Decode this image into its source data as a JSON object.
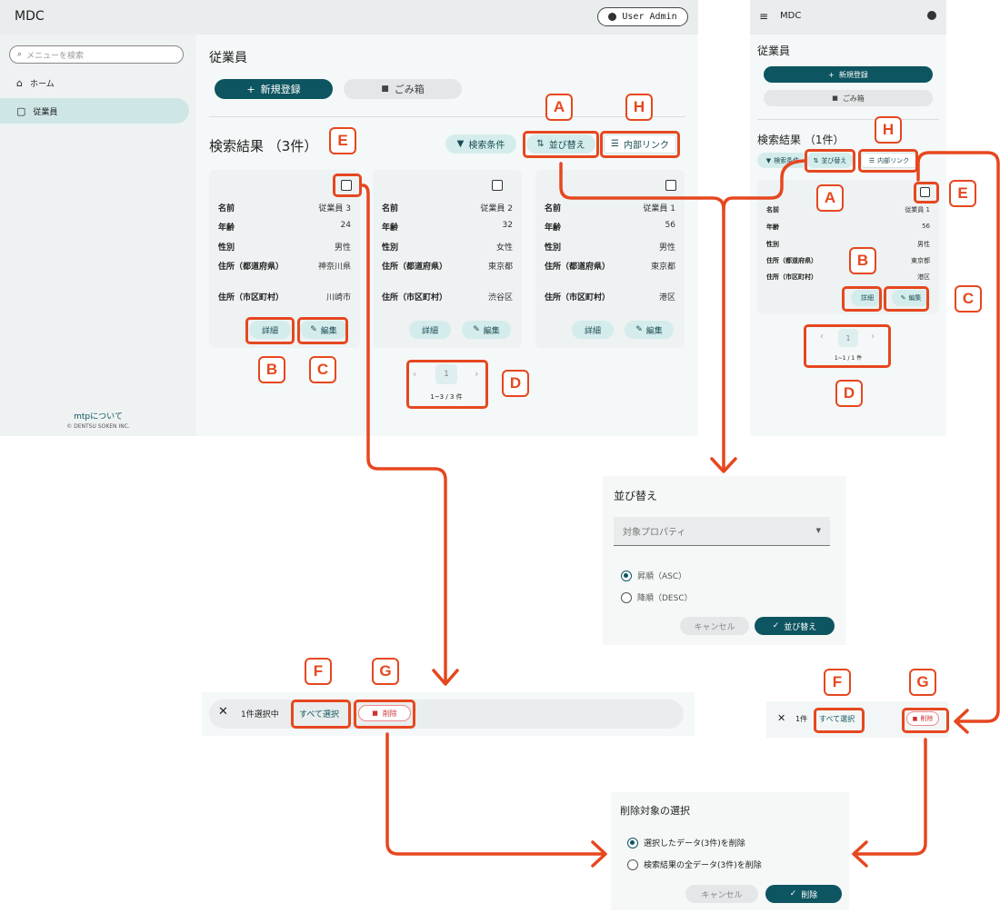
{
  "app": {
    "title": "MDC",
    "user": "User Admin"
  },
  "sidebar": {
    "search_placeholder": "メニューを検索",
    "items": [
      {
        "label": "ホーム"
      },
      {
        "label": "従業員"
      }
    ],
    "footer_link": "mtpについて",
    "footer_copy": "© DENTSU SOKEN INC."
  },
  "page": {
    "title": "従業員",
    "new_label": "新規登録",
    "trash_label": "ごみ箱",
    "results_title": "検索結果",
    "results_count": "（3件）",
    "filter_label": "検索条件",
    "sort_label": "並び替え",
    "link_label": "内部リンク"
  },
  "fields": [
    "名前",
    "年齢",
    "性別",
    "住所（都道府県）",
    "住所（市区町村）"
  ],
  "cards": [
    {
      "name": "従業員 3",
      "age": "24",
      "gender": "男性",
      "pref": "神奈川県",
      "city": "川崎市"
    },
    {
      "name": "従業員 2",
      "age": "32",
      "gender": "女性",
      "pref": "東京都",
      "city": "渋谷区"
    },
    {
      "name": "従業員 1",
      "age": "56",
      "gender": "男性",
      "pref": "東京都",
      "city": "港区"
    }
  ],
  "card_actions": {
    "detail": "詳細",
    "edit": "編集"
  },
  "pager": {
    "page": "1",
    "range": "1~3 / 3 件"
  },
  "mobile": {
    "title": "MDC",
    "page_title": "従業員",
    "new_label": "新規登録",
    "trash_label": "ごみ箱",
    "results_title": "検索結果",
    "results_count": "（1件）",
    "filter_label": "検索条件",
    "sort_label": "並び替え",
    "link_label": "内部リンク",
    "card": {
      "name": "従業員 1",
      "age": "56",
      "gender": "男性",
      "pref": "東京都",
      "city": "港区"
    },
    "fields": [
      "名前",
      "年齢",
      "性別",
      "住所（都道府県）",
      "住所（市区町村）"
    ],
    "pager": {
      "page": "1",
      "range": "1~1 / 1 件"
    },
    "select_count": "1件",
    "select_all": "すべて選択",
    "delete_label": "削除"
  },
  "sort_dialog": {
    "title": "並び替え",
    "select_placeholder": "対象プロパティ",
    "asc": "昇順（ASC）",
    "desc": "降順（DESC）",
    "cancel": "キャンセル",
    "confirm": "並び替え"
  },
  "selection_bar": {
    "count": "1件選択中",
    "select_all": "すべて選択",
    "delete_label": "削除"
  },
  "delete_dialog": {
    "title": "削除対象の選択",
    "opt_selected": "選択したデータ(3件)を削除",
    "opt_all": "検索結果の全データ(3件)を削除",
    "cancel": "キャンセル",
    "confirm": "削除"
  },
  "badges": {
    "A": "A",
    "B": "B",
    "C": "C",
    "D": "D",
    "E": "E",
    "F": "F",
    "G": "G",
    "H": "H"
  },
  "colors": {
    "accent": "#0d5560",
    "highlight": "#e6471f",
    "panel": "#eef2f2"
  }
}
